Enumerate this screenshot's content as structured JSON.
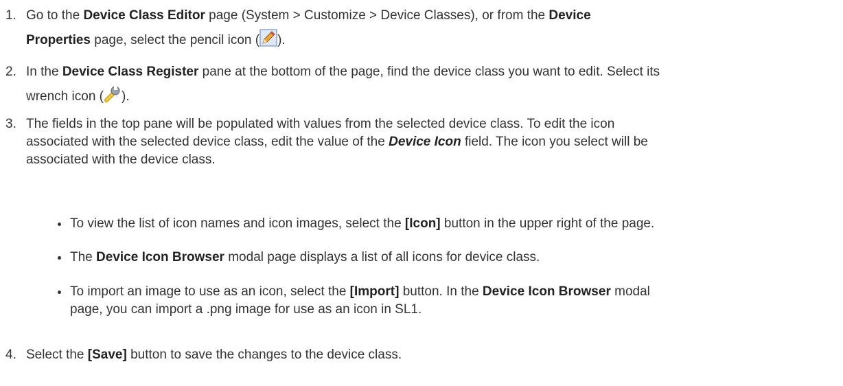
{
  "steps": [
    {
      "num": "1.",
      "a": "Go to the ",
      "b1": "Device Class Editor",
      "c": " page (System > Customize > Device Classes), or from the ",
      "b2": "Device",
      "b3": "Properties",
      "d": " page, select the pencil icon (",
      "e": ")."
    },
    {
      "num": "2.",
      "a": "In the ",
      "b1": "Device Class Register",
      "c": " pane at the bottom of the page, find the device class you want to edit. Select its",
      "d": "wrench icon (",
      "e": ")."
    },
    {
      "num": "3.",
      "a": "The fields in the top pane will be populated with values from the selected device class. To edit the icon",
      "b": "associated with the selected device class, edit the value of the ",
      "bi": "Device Icon",
      "c": " field. The icon you select will be",
      "d": "associated with the device class."
    },
    {
      "num": "4.",
      "a": "Select the ",
      "b1": "[Save]",
      "c": " button to save the changes to the device class."
    }
  ],
  "bullets": [
    {
      "a": "To view the list of icon names and icon images, select the ",
      "b": "[Icon]",
      "c": " button in the upper right of the page."
    },
    {
      "a": "The ",
      "b": "Device Icon Browser",
      "c": " modal page displays a list of all icons for device class."
    },
    {
      "a": "To import an image to use as an icon, select the ",
      "b": "[Import]",
      "c": " button. In the ",
      "b2": "Device Icon Browser",
      "d": " modal",
      "e": "page, you can import a .png image for use as an icon in SL1."
    }
  ],
  "icons": {
    "pencil": "pencil-icon",
    "wrench": "wrench-icon"
  }
}
